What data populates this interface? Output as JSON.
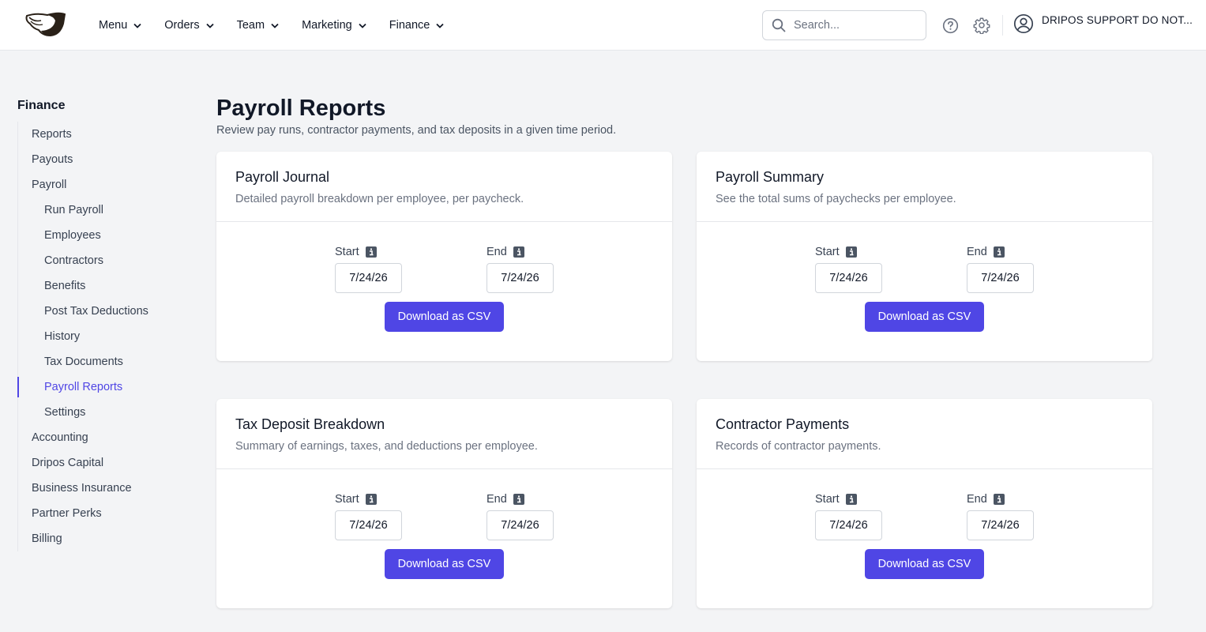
{
  "header": {
    "nav": [
      {
        "label": "Menu"
      },
      {
        "label": "Orders"
      },
      {
        "label": "Team"
      },
      {
        "label": "Marketing"
      },
      {
        "label": "Finance"
      }
    ],
    "search": {
      "placeholder": "Search...",
      "value": ""
    },
    "user": {
      "name": "DRIPOS SUPPORT DO NOT..."
    }
  },
  "sidebar": {
    "title": "Finance",
    "items": [
      {
        "label": "Reports",
        "level": 1
      },
      {
        "label": "Payouts",
        "level": 1
      },
      {
        "label": "Payroll",
        "level": 1
      },
      {
        "label": "Run Payroll",
        "level": 2
      },
      {
        "label": "Employees",
        "level": 2
      },
      {
        "label": "Contractors",
        "level": 2
      },
      {
        "label": "Benefits",
        "level": 2
      },
      {
        "label": "Post Tax Deductions",
        "level": 2
      },
      {
        "label": "History",
        "level": 2
      },
      {
        "label": "Tax Documents",
        "level": 2
      },
      {
        "label": "Payroll Reports",
        "level": 2,
        "active": true
      },
      {
        "label": "Settings",
        "level": 2
      },
      {
        "label": "Accounting",
        "level": 1
      },
      {
        "label": "Dripos Capital",
        "level": 1
      },
      {
        "label": "Business Insurance",
        "level": 1
      },
      {
        "label": "Partner Perks",
        "level": 1
      },
      {
        "label": "Billing",
        "level": 1
      }
    ]
  },
  "main": {
    "title": "Payroll Reports",
    "subtitle": "Review pay runs, contractor payments, and tax deposits in a given time period.",
    "cards": [
      {
        "title": "Payroll Journal",
        "description": "Detailed payroll breakdown per employee, per paycheck.",
        "start_label": "Start",
        "start_value": "7/24/26",
        "end_label": "End",
        "end_value": "7/24/26",
        "button": "Download as CSV"
      },
      {
        "title": "Payroll Summary",
        "description": "See the total sums of paychecks per employee.",
        "start_label": "Start",
        "start_value": "7/24/26",
        "end_label": "End",
        "end_value": "7/24/26",
        "button": "Download as CSV"
      },
      {
        "title": "Tax Deposit Breakdown",
        "description": "Summary of earnings, taxes, and deductions per employee.",
        "start_label": "Start",
        "start_value": "7/24/26",
        "end_label": "End",
        "end_value": "7/24/26",
        "button": "Download as CSV"
      },
      {
        "title": "Contractor Payments",
        "description": "Records of contractor payments.",
        "start_label": "Start",
        "start_value": "7/24/26",
        "end_label": "End",
        "end_value": "7/24/26",
        "button": "Download as CSV"
      }
    ]
  },
  "colors": {
    "accent": "#4f46e5",
    "active_text": "#5046e5",
    "background": "#f3f4f6"
  }
}
